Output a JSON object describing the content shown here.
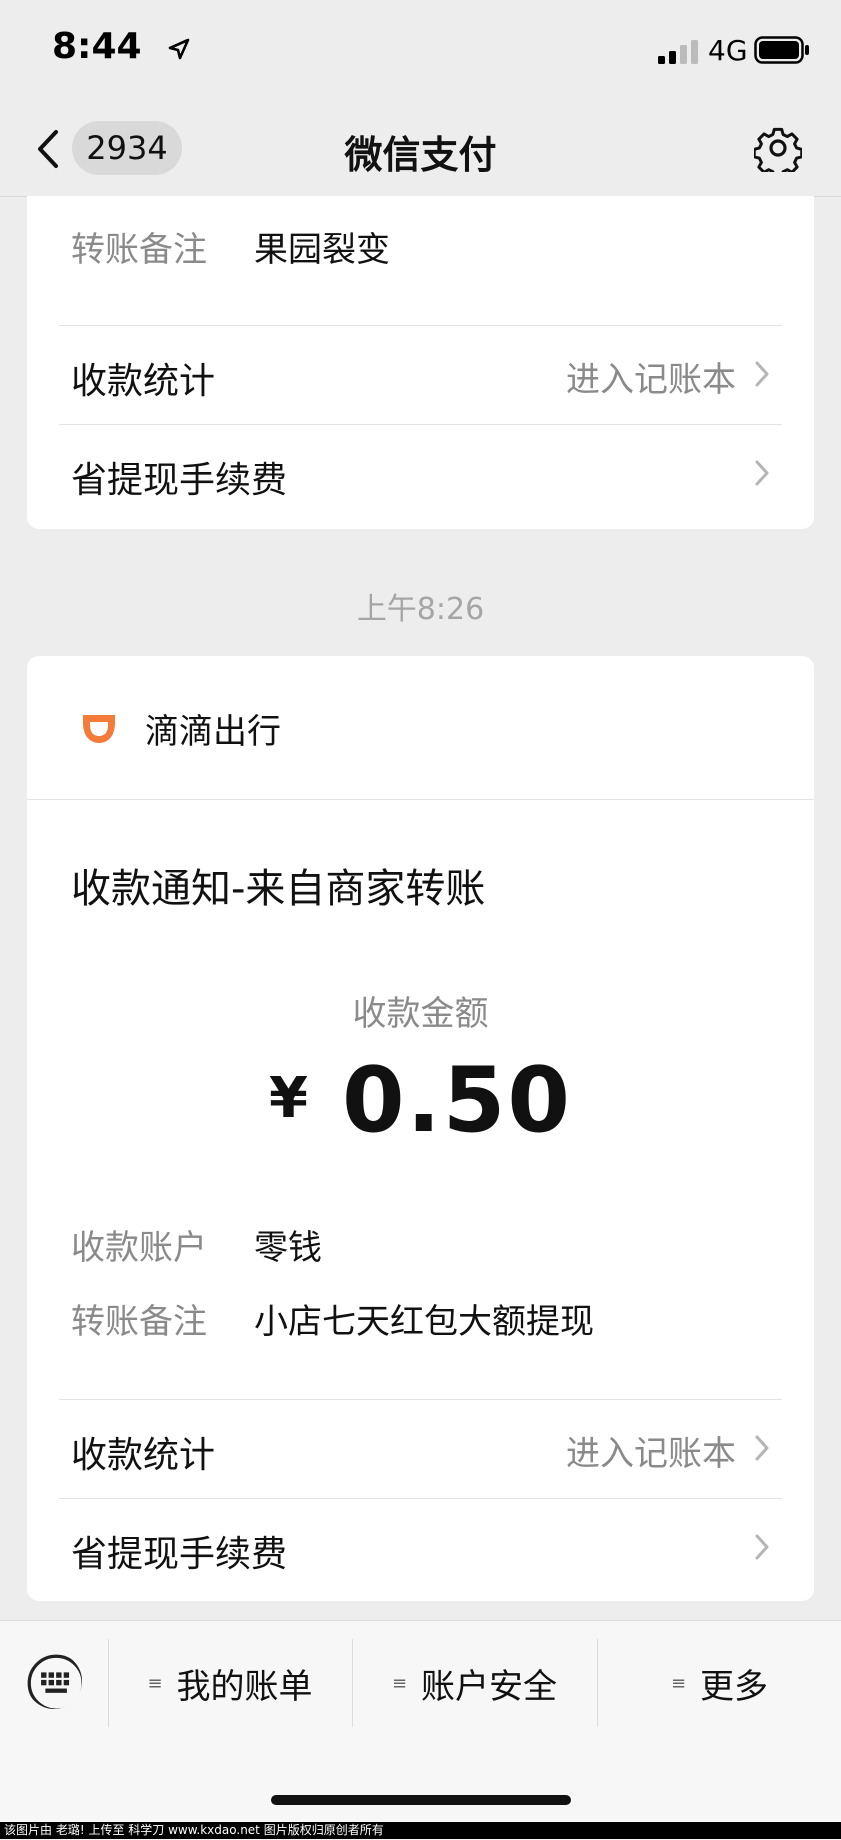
{
  "status_bar": {
    "time": "8:44",
    "network": "4G",
    "icons": [
      "location-arrow-icon",
      "signal-icon",
      "battery-icon"
    ]
  },
  "nav": {
    "badge": "2934",
    "title": "微信支付",
    "icons": [
      "back-icon",
      "gear-icon"
    ]
  },
  "top_card": {
    "note_label": "转账备注",
    "note_value": "果园裂变",
    "stats_label": "收款统计",
    "stats_link": "进入记账本",
    "fee_label": "省提现手续费"
  },
  "timestamp": "上午8:26",
  "main_card": {
    "merchant": "滴滴出行",
    "notice_title": "收款通知-来自商家转账",
    "amount_label": "收款金额",
    "currency": "¥",
    "amount": "0.50",
    "account_label": "收款账户",
    "account_value": "零钱",
    "note_label": "转账备注",
    "note_value": "小店七天红包大额提现",
    "stats_label": "收款统计",
    "stats_link": "进入记账本",
    "fee_label": "省提现手续费"
  },
  "toolbar": {
    "items": [
      {
        "label": "我的账单"
      },
      {
        "label": "账户安全"
      },
      {
        "label": "更多"
      }
    ]
  },
  "watermark": "该图片由 老璐! 上传至 科学刀 www.kxdao.net 图片版权归原创者所有",
  "colors": {
    "didi_orange": "#f47b39",
    "secondary_text": "#8a8a8a"
  }
}
